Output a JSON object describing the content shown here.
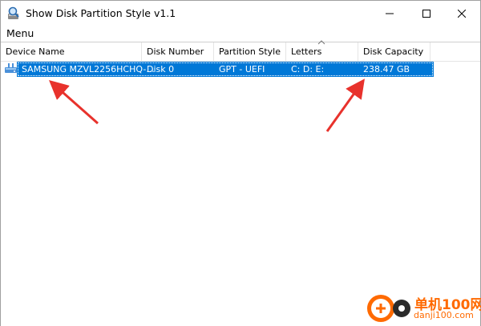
{
  "window": {
    "title": "Show Disk Partition Style v1.1"
  },
  "menu": {
    "items": [
      "Menu"
    ]
  },
  "list": {
    "columns": [
      "Device Name",
      "Disk Number",
      "Partition Style",
      "Letters",
      "Disk Capacity"
    ],
    "sorted_column": "Letters",
    "rows": [
      {
        "device_name": "SAMSUNG MZVL2256HCHQ-...",
        "disk_number": "Disk 0",
        "partition_style": "GPT - UEFI",
        "letters": "C:  D:  E:",
        "disk_capacity": "238.47 GB",
        "selected": true
      }
    ]
  },
  "colors": {
    "selection": "#0078d7",
    "annotation_arrow": "#e8322c",
    "watermark": "#ff6a00"
  },
  "watermark": {
    "name": "单机100网",
    "url": "danji100.com"
  }
}
